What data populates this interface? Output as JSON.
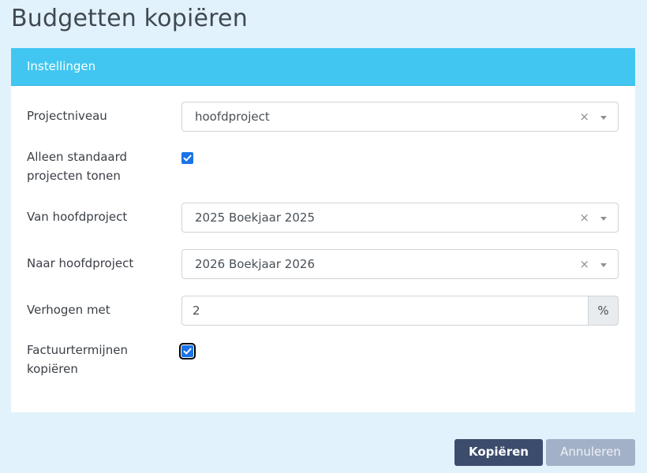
{
  "page": {
    "title": "Budgetten kopiëren"
  },
  "panel": {
    "header": "Instellingen"
  },
  "form": {
    "projectniveau": {
      "label": "Projectniveau",
      "value": "hoofdproject",
      "clear": "×"
    },
    "alleen_standaard": {
      "label_line1": "Alleen standaard",
      "label_line2": "projecten tonen",
      "checked": true
    },
    "van_hoofdproject": {
      "label": "Van hoofdproject",
      "value": "2025 Boekjaar 2025",
      "clear": "×"
    },
    "naar_hoofdproject": {
      "label": "Naar hoofdproject",
      "value": "2026 Boekjaar 2026",
      "clear": "×"
    },
    "verhogen_met": {
      "label": "Verhogen met",
      "value": "2",
      "unit": "%"
    },
    "factuurtermijnen": {
      "label_line1": "Factuurtermijnen",
      "label_line2": "kopiëren",
      "checked": true
    }
  },
  "buttons": {
    "copy": "Kopiëren",
    "cancel": "Annuleren"
  },
  "colors": {
    "header": "#41c6f1",
    "primary": "#3c4c6c",
    "secondary": "#a3b1c8",
    "checkbox": "#1a73e8"
  }
}
